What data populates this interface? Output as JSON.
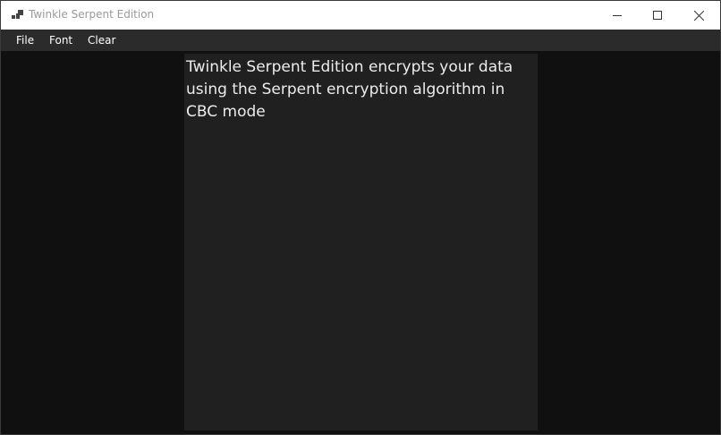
{
  "window": {
    "title": "Twinkle Serpent Edition"
  },
  "menu": {
    "items": [
      {
        "label": "File"
      },
      {
        "label": "Font"
      },
      {
        "label": "Clear"
      }
    ]
  },
  "editor": {
    "text": "Twinkle Serpent Edition encrypts your data using the Serpent encryption algorithm in CBC mode"
  }
}
